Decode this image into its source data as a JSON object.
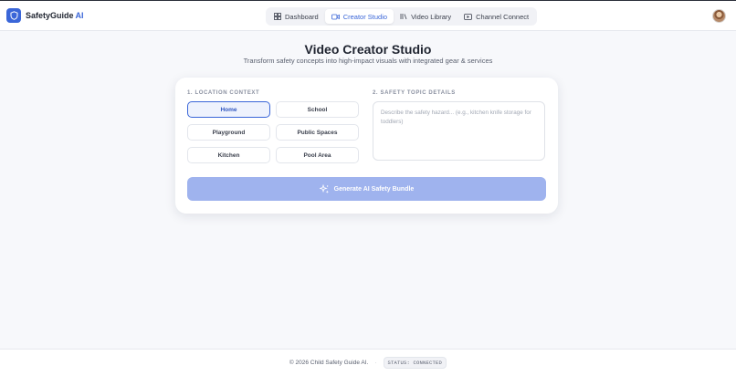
{
  "brand": {
    "name": "SafetyGuide",
    "accent": "AI",
    "logo_icon": "shield-icon"
  },
  "nav": {
    "tabs": [
      {
        "label": "Dashboard",
        "icon": "grid-icon",
        "active": false
      },
      {
        "label": "Creator Studio",
        "icon": "video-camera-icon",
        "active": true
      },
      {
        "label": "Video Library",
        "icon": "library-icon",
        "active": false
      },
      {
        "label": "Channel Connect",
        "icon": "play-box-icon",
        "active": false
      }
    ]
  },
  "page": {
    "title": "Video Creator Studio",
    "subtitle": "Transform safety concepts into high-impact visuals with integrated gear & services"
  },
  "location": {
    "label": "1. LOCATION CONTEXT",
    "options": [
      "Home",
      "School",
      "Playground",
      "Public Spaces",
      "Kitchen",
      "Pool Area"
    ],
    "selected": "Home"
  },
  "topic": {
    "label": "2. SAFETY TOPIC DETAILS",
    "value": "",
    "placeholder": "Describe the safety hazard... (e.g., kitchen knife storage for toddlers)"
  },
  "generate": {
    "label": "Generate AI Safety Bundle",
    "icon": "sparkles-icon"
  },
  "footer": {
    "copyright": "© 2026 Child Safety Guide AI.",
    "separator": "·",
    "status": "STATUS: CONNECTED"
  },
  "colors": {
    "accent": "#3a66d8",
    "button_disabled": "#9fb3ee",
    "background": "#f7f8fb"
  }
}
